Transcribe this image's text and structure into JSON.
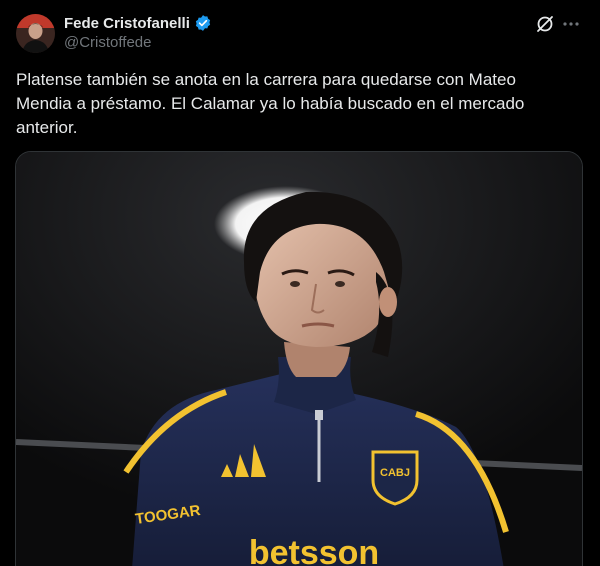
{
  "author": {
    "display_name": "Fede Cristofanelli",
    "handle": "@Cristoffede",
    "verified": true
  },
  "tweet": {
    "text": "Platense también se anota en la carrera para quedarse con Mateo\nMendia a préstamo. El Calamar ya lo había buscado en el mercado\nanterior."
  },
  "actions": {
    "grok_icon": "grok-icon",
    "more_icon": "more-dots-icon"
  },
  "media": {
    "jersey_text_left": "TOOGAR",
    "jersey_text_center": "betsson",
    "crest_text": "CABJ"
  },
  "colors": {
    "background": "#000000",
    "text_primary": "#e7e9ea",
    "text_secondary": "#71767b",
    "verified_blue": "#1d9bf0",
    "jersey_navy": "#1c2647",
    "jersey_gold": "#f2c230"
  }
}
